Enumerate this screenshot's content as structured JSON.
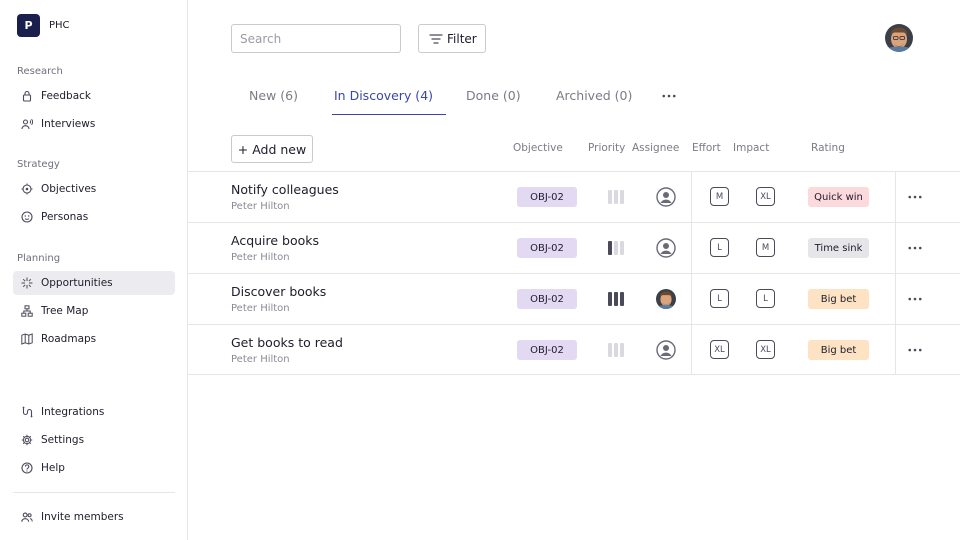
{
  "brand": {
    "logo_letter": "P",
    "name": "PHC"
  },
  "sidebar": {
    "sections": [
      {
        "title": "Research",
        "items": [
          {
            "label": "Feedback",
            "icon": "lock-icon"
          },
          {
            "label": "Interviews",
            "icon": "user-voice-icon"
          }
        ]
      },
      {
        "title": "Strategy",
        "items": [
          {
            "label": "Objectives",
            "icon": "target-icon"
          },
          {
            "label": "Personas",
            "icon": "face-icon"
          }
        ]
      },
      {
        "title": "Planning",
        "items": [
          {
            "label": "Opportunities",
            "icon": "sparkle-icon",
            "active": true
          },
          {
            "label": "Tree Map",
            "icon": "tree-icon"
          },
          {
            "label": "Roadmaps",
            "icon": "map-icon"
          }
        ]
      }
    ],
    "bottom": [
      {
        "label": "Integrations",
        "icon": "integrations-icon"
      },
      {
        "label": "Settings",
        "icon": "gear-icon"
      },
      {
        "label": "Help",
        "icon": "help-icon"
      }
    ],
    "invite": {
      "label": "Invite members",
      "icon": "users-icon"
    }
  },
  "header": {
    "search_placeholder": "Search",
    "filter_label": "Filter"
  },
  "tabs": [
    {
      "label": "New (6)",
      "active": false
    },
    {
      "label": "In Discovery (4)",
      "active": true
    },
    {
      "label": "Done (0)",
      "active": false
    },
    {
      "label": "Archived (0)",
      "active": false
    }
  ],
  "table": {
    "add_label": "+ Add new",
    "columns": {
      "objective": "Objective",
      "priority": "Priority",
      "assignee": "Assignee",
      "effort": "Effort",
      "impact": "Impact",
      "rating": "Rating"
    },
    "rows": [
      {
        "title": "Notify colleagues",
        "owner": "Peter Hilton",
        "objective": "OBJ-02",
        "priority": 0,
        "assignee": "placeholder",
        "effort": "M",
        "impact": "XL",
        "rating": "Quick win",
        "rating_color": "#fbd9dc"
      },
      {
        "title": "Acquire books",
        "owner": "Peter Hilton",
        "objective": "OBJ-02",
        "priority": 1,
        "assignee": "placeholder",
        "effort": "L",
        "impact": "M",
        "rating": "Time sink",
        "rating_color": "#e6e6ea"
      },
      {
        "title": "Discover books",
        "owner": "Peter Hilton",
        "objective": "OBJ-02",
        "priority": 3,
        "assignee": "photo",
        "effort": "L",
        "impact": "L",
        "rating": "Big bet",
        "rating_color": "#fde3c4"
      },
      {
        "title": "Get books to read",
        "owner": "Peter Hilton",
        "objective": "OBJ-02",
        "priority": 0,
        "assignee": "placeholder",
        "effort": "XL",
        "impact": "XL",
        "rating": "Big bet",
        "rating_color": "#fde3c4"
      }
    ]
  },
  "colors": {
    "accent": "#3a47a8",
    "brand": "#1a1f4e",
    "objective_badge": "#e4d9f3",
    "active_nav": "#ececf0"
  }
}
